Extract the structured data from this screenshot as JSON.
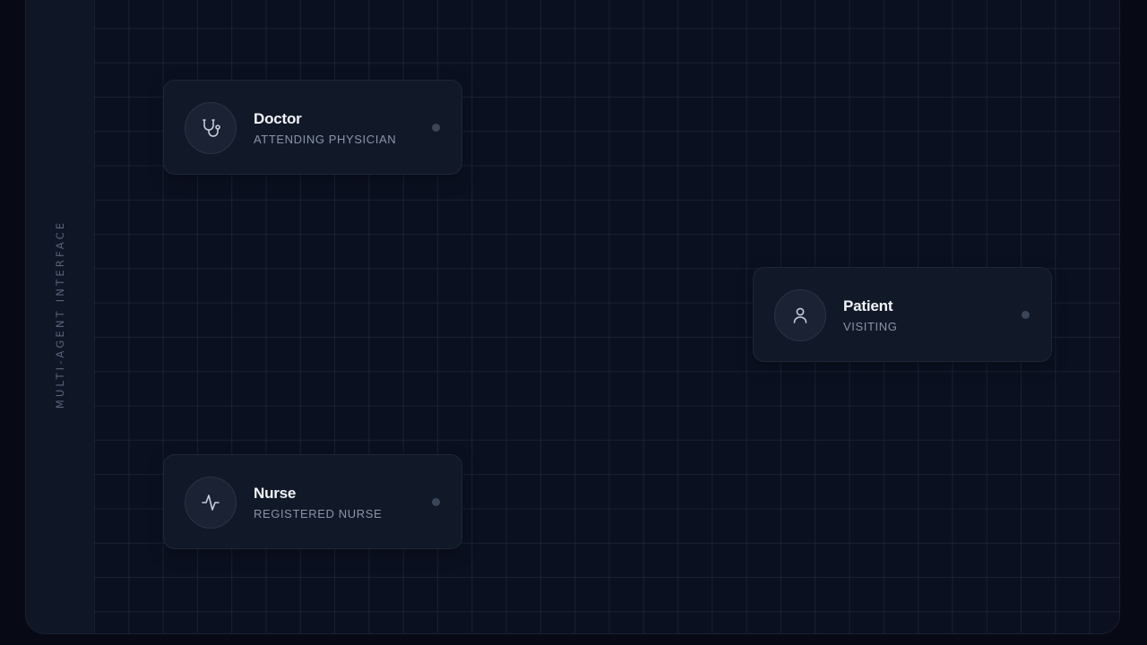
{
  "sidebar": {
    "label": "MULTI-AGENT INTERFACE"
  },
  "agents": [
    {
      "name": "Doctor",
      "role": "ATTENDING PHYSICIAN",
      "icon": "stethoscope-icon"
    },
    {
      "name": "Patient",
      "role": "VISITING",
      "icon": "user-icon"
    },
    {
      "name": "Nurse",
      "role": "REGISTERED NURSE",
      "icon": "pulse-icon"
    }
  ],
  "colors": {
    "background": "#0b1020",
    "card": "#111827",
    "text_primary": "#f1f4f9",
    "text_secondary": "#8a95aa",
    "status_idle": "#3b4558"
  }
}
